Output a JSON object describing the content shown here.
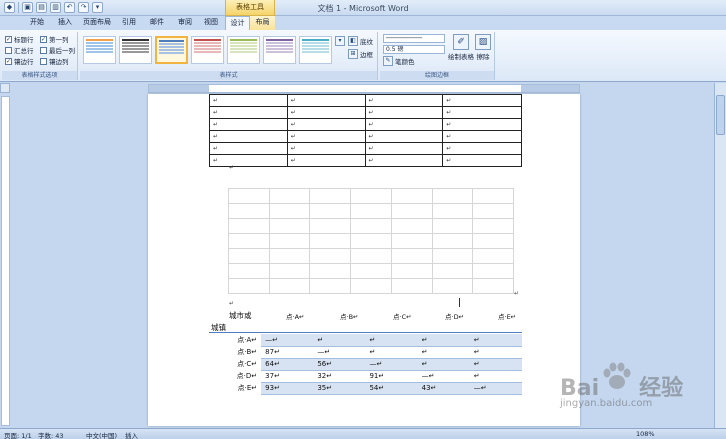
{
  "window": {
    "title": "文档 1 - Microsoft Word",
    "context_tab_group": "表格工具"
  },
  "tabs": [
    {
      "label": "开始"
    },
    {
      "label": "插入"
    },
    {
      "label": "页面布局"
    },
    {
      "label": "引用"
    },
    {
      "label": "邮件"
    },
    {
      "label": "审阅"
    },
    {
      "label": "视图"
    },
    {
      "label": "设计"
    },
    {
      "label": "布局"
    }
  ],
  "ribbon": {
    "style_options": {
      "label": "表格样式选项",
      "items": [
        {
          "label": "标题行",
          "checked": true
        },
        {
          "label": "第一列",
          "checked": true
        },
        {
          "label": "汇总行",
          "checked": false
        },
        {
          "label": "最后一列",
          "checked": false
        },
        {
          "label": "镶边行",
          "checked": true
        },
        {
          "label": "镶边列",
          "checked": false
        }
      ]
    },
    "table_styles": {
      "label": "表样式",
      "shading": "底纹",
      "borders": "边框"
    },
    "draw_borders": {
      "label": "绘图边框",
      "pen_weight": "0.5 磅",
      "pen_color": "笔颜色",
      "draw_table": "绘制表格",
      "eraser": "擦除"
    },
    "colors": {
      "accent_selected": "#f2b440",
      "ribbon": "#dce8f7"
    }
  },
  "document": {
    "pilcrow": "↵",
    "header_cells": [
      "城市或",
      "点·A↵",
      "点·B↵",
      "点·C↵",
      "点·D↵",
      "点·E↵"
    ],
    "header_sub": "城镇",
    "rows": [
      {
        "label": "点·A↵",
        "cells": [
          "—↵",
          "↵",
          "↵",
          "↵",
          "↵"
        ]
      },
      {
        "label": "点·B↵",
        "cells": [
          "87↵",
          "—↵",
          "↵",
          "↵",
          "↵"
        ]
      },
      {
        "label": "点·C↵",
        "cells": [
          "64↵",
          "56↵",
          "—↵",
          "↵",
          "↵"
        ]
      },
      {
        "label": "点·D↵",
        "cells": [
          "37↵",
          "32↵",
          "91↵",
          "—↵",
          "↵"
        ]
      },
      {
        "label": "点·E↵",
        "cells": [
          "93↵",
          "35↵",
          "54↵",
          "43↵",
          "—↵"
        ]
      }
    ]
  },
  "statusbar": {
    "page": "页面: 1/1",
    "words": "字数: 43",
    "language": "中文(中国)",
    "mode": "插入",
    "zoom": "108%"
  },
  "watermark": {
    "brand": "Bai",
    "brand2": "经验",
    "url": "jingyan.baidu.com"
  }
}
